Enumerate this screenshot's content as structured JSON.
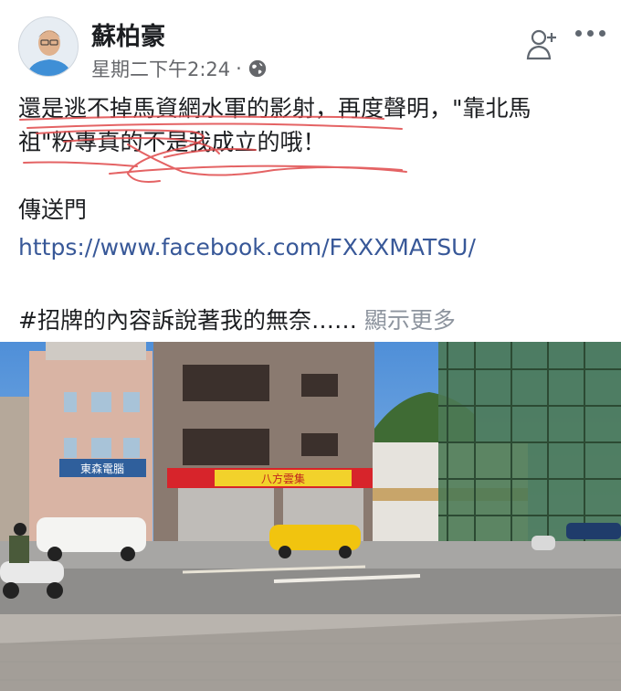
{
  "post": {
    "author": "蘇柏豪",
    "timestamp": "星期二下午2:24",
    "separator": "·",
    "privacy_icon": "globe-icon",
    "line1": "還是逃不掉馬資網水軍的影射，再度聲明，\"靠北馬",
    "line2": "祖\"粉專真的不是我成立的哦！",
    "portal_label": "傳送門",
    "link": "https://www.facebook.com/FXXXMATSU/",
    "hashtag_line": "#招牌的內容訴說著我的無奈……",
    "see_more": "顯示更多"
  },
  "photo": {
    "description_icon": "street-photo",
    "shop_signs": [
      "八方雲集",
      "東森電腦"
    ]
  },
  "colors": {
    "link": "#385898",
    "text": "#1c1e21",
    "meta": "#65676b",
    "scribble": "#e0484a"
  }
}
